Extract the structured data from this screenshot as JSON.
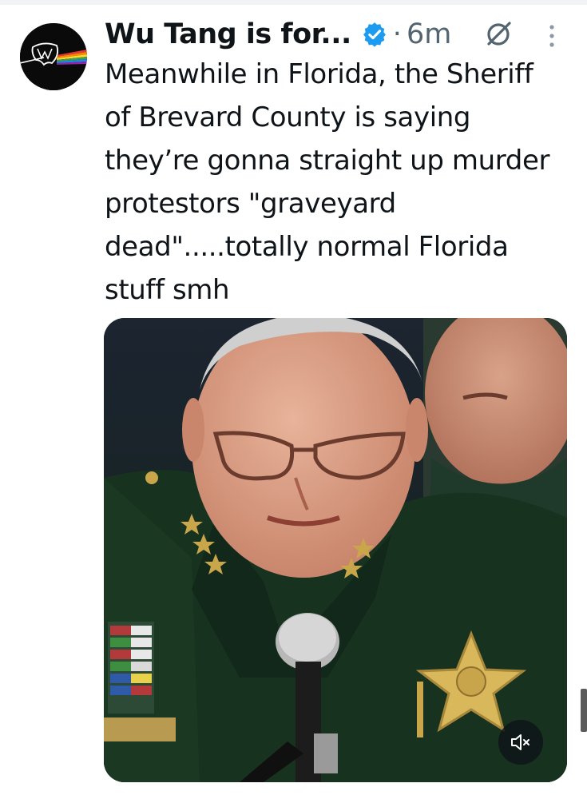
{
  "tweet": {
    "display_name": "Wu Tang is for...",
    "separator": "·",
    "timestamp": "6m",
    "text": "Meanwhile in Florida, the Sheriff of Brevard County is saying they’re gonna straight up murder protestors \"graveyard dead\".....totally normal Florida stuff smh"
  },
  "icons": {
    "verified": "verified-badge-icon",
    "grok": "grok-icon",
    "more": "more-options-icon",
    "mute": "volume-muted-icon"
  },
  "colors": {
    "verified_blue": "#1d9bf0",
    "secondary_text": "#536471",
    "primary_text": "#0f1419"
  }
}
